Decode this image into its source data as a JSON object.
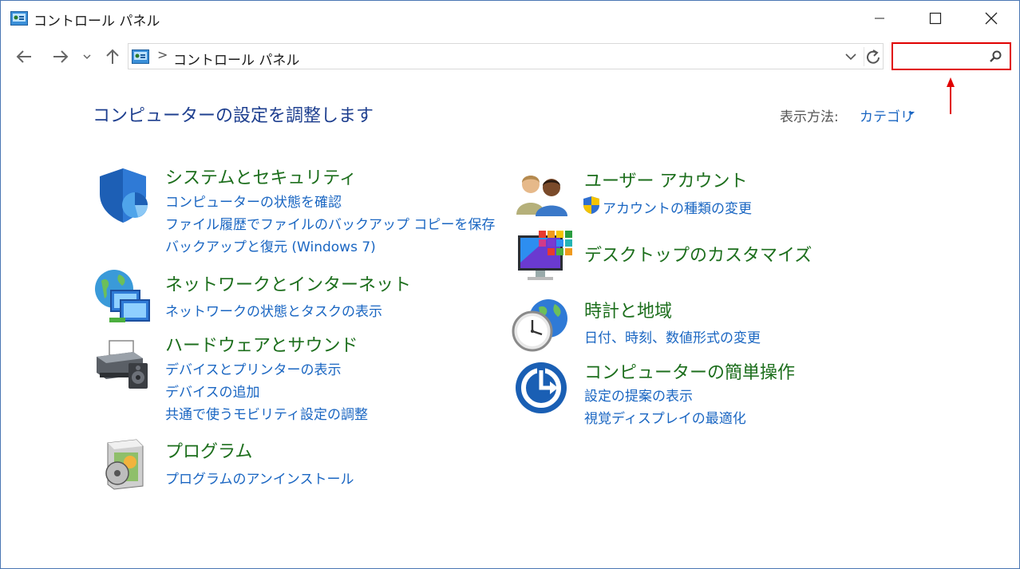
{
  "window": {
    "title": "コントロール パネル"
  },
  "address_bar": {
    "path": "コントロール パネル",
    "separator": ">"
  },
  "search": {
    "value": "",
    "placeholder": ""
  },
  "header": {
    "title": "コンピューターの設定を調整します",
    "view_by_label": "表示方法:",
    "view_by_value": "カテゴリ"
  },
  "categories": {
    "system_security": {
      "title": "システムとセキュリティ",
      "links": [
        "コンピューターの状態を確認",
        "ファイル履歴でファイルのバックアップ コピーを保存",
        "バックアップと復元 (Windows 7)"
      ]
    },
    "network_internet": {
      "title": "ネットワークとインターネット",
      "links": [
        "ネットワークの状態とタスクの表示"
      ]
    },
    "hardware_sound": {
      "title": "ハードウェアとサウンド",
      "links": [
        "デバイスとプリンターの表示",
        "デバイスの追加",
        "共通で使うモビリティ設定の調整"
      ]
    },
    "programs": {
      "title": "プログラム",
      "links": [
        "プログラムのアンインストール"
      ]
    },
    "user_accounts": {
      "title": "ユーザー アカウント",
      "links": [
        "アカウントの種類の変更"
      ]
    },
    "desktop_customize": {
      "title": "デスクトップのカスタマイズ",
      "links": []
    },
    "clock_region": {
      "title": "時計と地域",
      "links": [
        "日付、時刻、数値形式の変更"
      ]
    },
    "ease_of_access": {
      "title": "コンピューターの簡単操作",
      "links": [
        "設定の提案の表示",
        "視覚ディスプレイの最適化"
      ]
    }
  },
  "colors": {
    "title_blue": "#1e3f8f",
    "category_green": "#1c6e1c",
    "link_blue": "#1a66c2",
    "highlight_red": "#e00000"
  }
}
